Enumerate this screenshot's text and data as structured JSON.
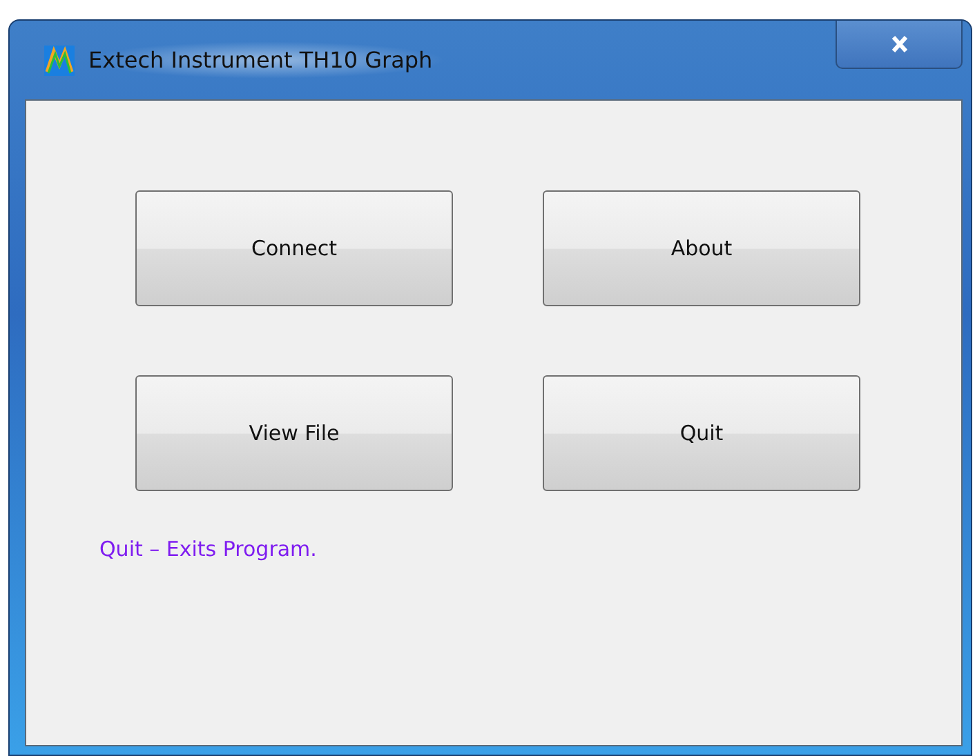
{
  "window": {
    "title": "Extech Instrument TH10 Graph"
  },
  "buttons": [
    {
      "label": "Connect"
    },
    {
      "label": "About"
    },
    {
      "label": "View File"
    },
    {
      "label": "Quit"
    }
  ],
  "status_text": "Quit – Exits Program."
}
